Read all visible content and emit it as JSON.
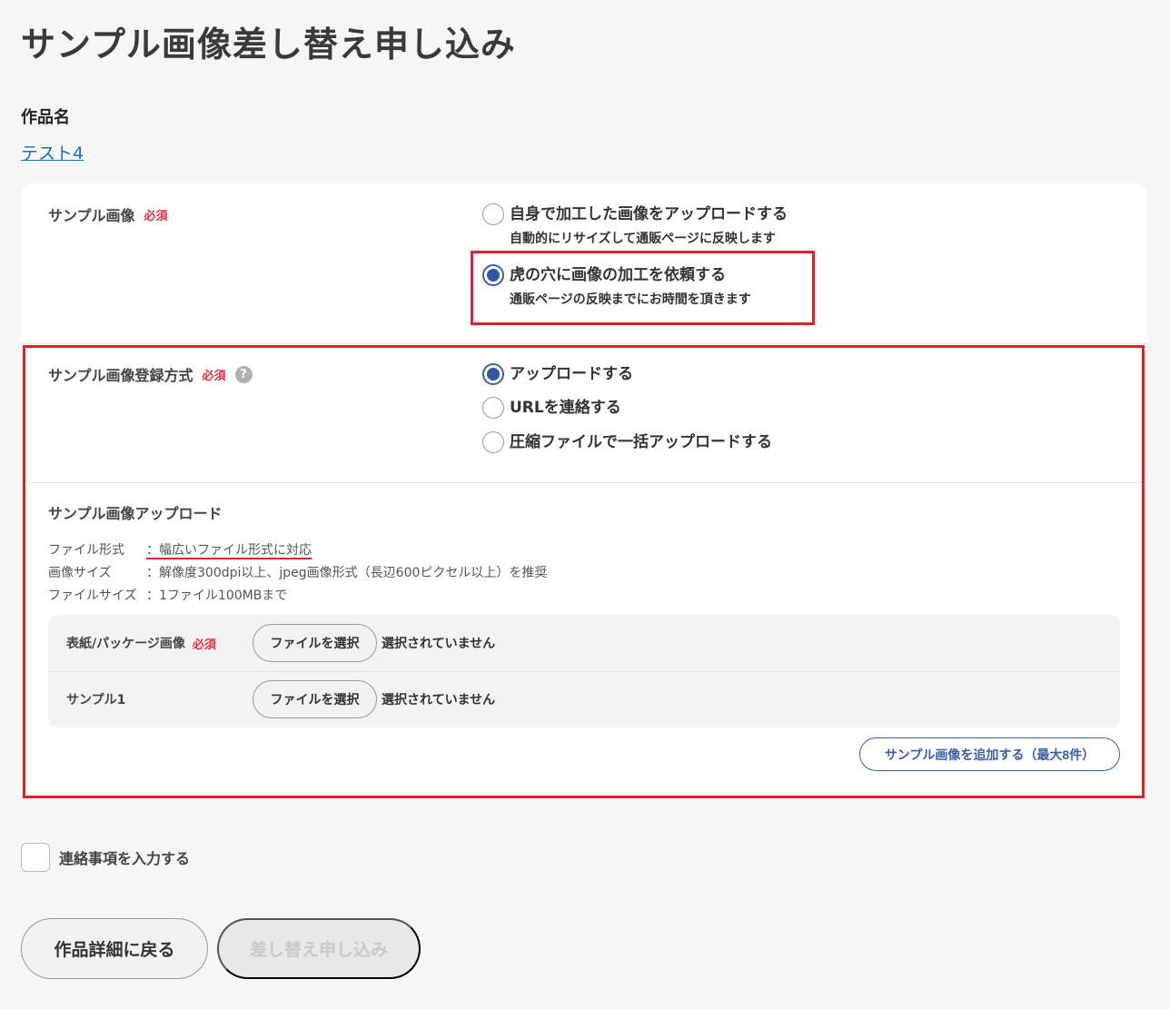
{
  "page": {
    "title": "サンプル画像差し替え申し込み",
    "work_label": "作品名",
    "work_link": "テスト4"
  },
  "sample_image": {
    "label": "サンプル画像",
    "required": "必須",
    "options": [
      {
        "main": "自身で加工した画像をアップロードする",
        "sub": "自動的にリサイズして通販ページに反映します",
        "selected": false
      },
      {
        "main": "虎の穴に画像の加工を依頼する",
        "sub": "通販ページの反映までにお時間を頂きます",
        "selected": true
      }
    ]
  },
  "register_method": {
    "label": "サンプル画像登録方式",
    "required": "必須",
    "help_icon": "?",
    "options": [
      {
        "main": "アップロードする",
        "selected": true
      },
      {
        "main": "URLを連絡する",
        "selected": false
      },
      {
        "main": "圧縮ファイルで一括アップロードする",
        "selected": false
      }
    ]
  },
  "upload": {
    "title": "サンプル画像アップロード",
    "specs": [
      {
        "key": "ファイル形式",
        "value": "：幅広いファイル形式に対応"
      },
      {
        "key": "画像サイズ",
        "value": "：解像度300dpi以上、jpeg画像形式（長辺600ピクセル以上）を推奨"
      },
      {
        "key": "ファイルサイズ",
        "value": "：1ファイル100MBまで"
      }
    ],
    "files": [
      {
        "label": "表紙/パッケージ画像",
        "required": "必須",
        "button": "ファイルを選択",
        "status": "選択されていません"
      },
      {
        "label": "サンプル1",
        "required": "",
        "button": "ファイルを選択",
        "status": "選択されていません"
      }
    ],
    "add_button": "サンプル画像を追加する（最大8件）"
  },
  "contact": {
    "label": "連絡事項を入力する",
    "checked": false
  },
  "actions": {
    "back": "作品詳細に戻る",
    "submit": "差し替え申し込み"
  },
  "colors": {
    "accent": "#2f57a6",
    "required": "#e0323e",
    "highlight": "#e0202e",
    "link": "#1a6fc2"
  }
}
